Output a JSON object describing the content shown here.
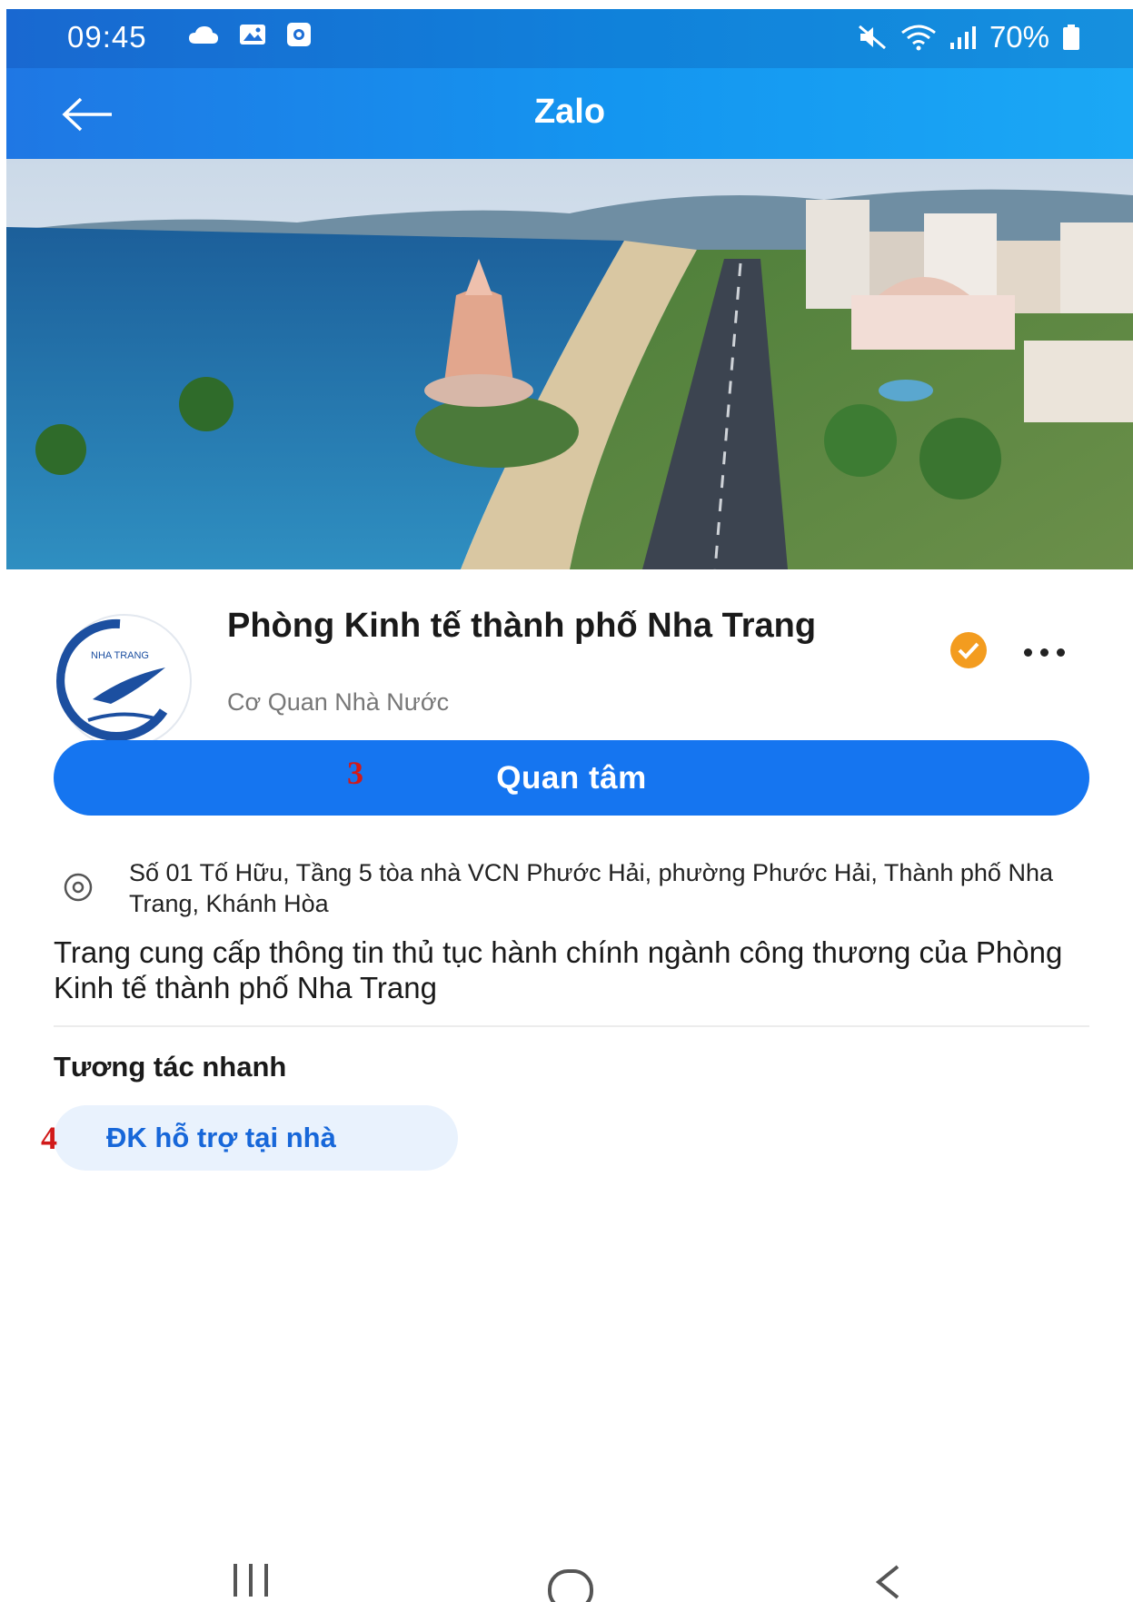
{
  "status_bar": {
    "time": "09:45",
    "battery": "70%",
    "icons": [
      "cloud-icon",
      "gallery-icon",
      "record-icon",
      "mute-icon",
      "wifi-icon",
      "signal-icon",
      "battery-icon"
    ]
  },
  "header": {
    "title": "Zalo",
    "back_icon": "arrow-left-icon"
  },
  "profile": {
    "name": "Phòng Kinh tế thành phố Nha Trang",
    "category": "Cơ Quan Nhà Nước",
    "logo_text": "NHA TRANG",
    "verified_icon": "verified-badge-icon",
    "more_icon": "more-dots-icon"
  },
  "follow_button": {
    "label": "Quan tâm"
  },
  "annotations": {
    "three": "3",
    "four": "4"
  },
  "address": "Số 01 Tố Hữu, Tầng 5 tòa nhà VCN Phước Hải, phường Phước Hải, Thành phố Nha Trang, Khánh Hòa",
  "description": "Trang cung cấp thông tin thủ tục hành chính ngành công thương của Phòng Kinh tế thành phố Nha Trang",
  "quick_actions": {
    "title": "Tương tác nhanh",
    "items": [
      {
        "label": "ĐK hỗ trợ tại nhà"
      }
    ]
  },
  "colors": {
    "header_blue": "#1496f0",
    "primary": "#1575f0",
    "chip_bg": "#e9f2fd",
    "verified": "#f39c1f",
    "annotation": "#d11a1a"
  },
  "nav_bar": {
    "icons": [
      "recent-apps-icon",
      "home-icon",
      "back-icon"
    ]
  }
}
